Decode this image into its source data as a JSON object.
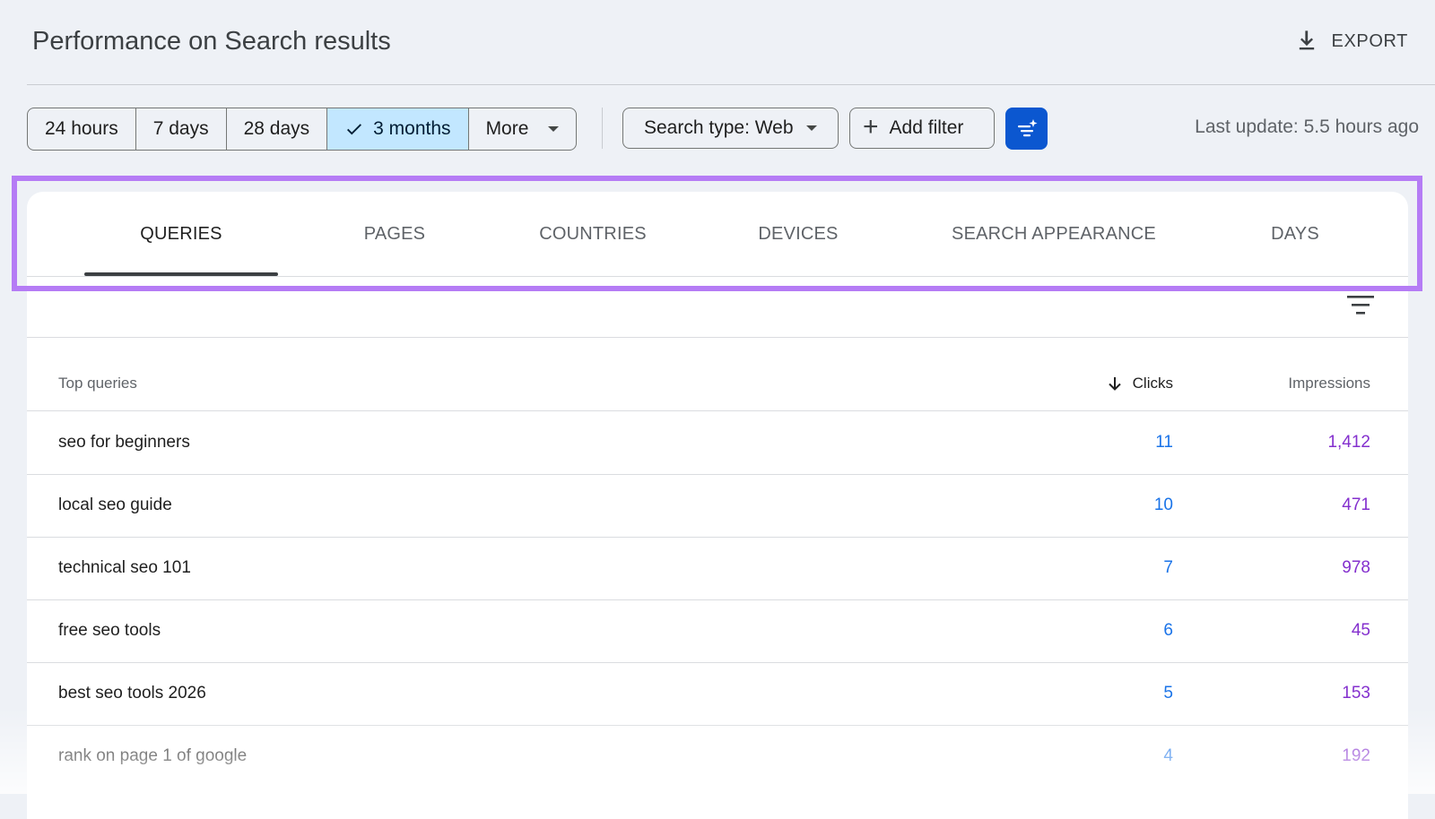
{
  "header": {
    "title": "Performance on Search results",
    "export_label": "EXPORT"
  },
  "date_filters": [
    {
      "label": "24 hours"
    },
    {
      "label": "7 days"
    },
    {
      "label": "28 days"
    },
    {
      "label": "3 months",
      "selected": true
    },
    {
      "label": "More"
    }
  ],
  "filters": {
    "search_type_label": "Search type: Web",
    "add_filter_label": "Add filter"
  },
  "last_update": "Last update: 5.5 hours ago",
  "tabs": [
    {
      "label": "QUERIES",
      "active": true
    },
    {
      "label": "PAGES"
    },
    {
      "label": "COUNTRIES"
    },
    {
      "label": "DEVICES"
    },
    {
      "label": "SEARCH APPEARANCE"
    },
    {
      "label": "DAYS"
    }
  ],
  "table": {
    "headers": {
      "query": "Top queries",
      "clicks": "Clicks",
      "impressions": "Impressions"
    },
    "rows": [
      {
        "query": "seo for beginners",
        "clicks": "11",
        "impressions": "1,412"
      },
      {
        "query": "local seo guide",
        "clicks": "10",
        "impressions": "471"
      },
      {
        "query": "technical seo 101",
        "clicks": "7",
        "impressions": "978"
      },
      {
        "query": "free seo tools",
        "clicks": "6",
        "impressions": "45"
      },
      {
        "query": "best seo tools 2026",
        "clicks": "5",
        "impressions": "153"
      },
      {
        "query": "rank on page 1 of google",
        "clicks": "4",
        "impressions": "192"
      }
    ]
  },
  "colors": {
    "highlight": "#b57cf5",
    "selected_chip": "#c2e7ff",
    "ai_button": "#0b57d0",
    "clicks_text": "#1a73e8",
    "impressions_text": "#8430ce"
  }
}
